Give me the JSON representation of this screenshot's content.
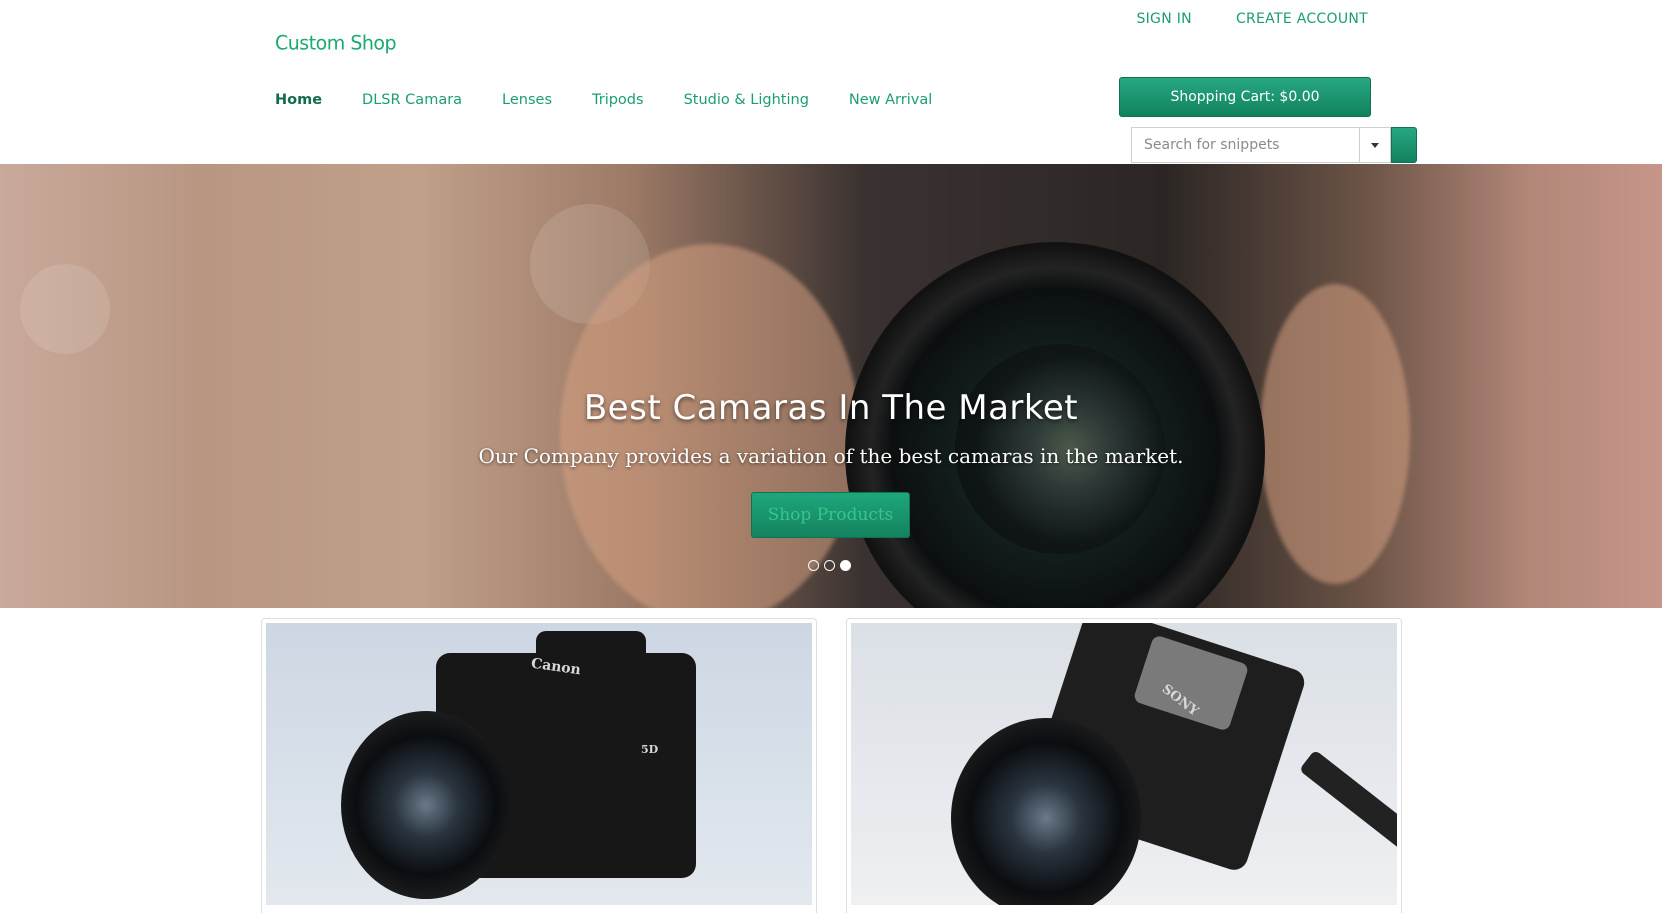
{
  "header": {
    "logo": "Custom Shop",
    "top_links": [
      "SIGN IN",
      "CREATE ACCOUNT"
    ],
    "nav": [
      {
        "label": "Home",
        "active": true
      },
      {
        "label": "DLSR Camara",
        "active": false
      },
      {
        "label": "Lenses",
        "active": false
      },
      {
        "label": "Tripods",
        "active": false
      },
      {
        "label": "Studio & Lighting",
        "active": false
      },
      {
        "label": "New Arrival",
        "active": false
      }
    ],
    "cart_label": "Shopping Cart: $0.00",
    "search": {
      "placeholder": "Search for snippets",
      "value": ""
    }
  },
  "hero": {
    "title": "Best Camaras In The Market",
    "subtitle": "Our Company provides a variation of the best camaras in the market.",
    "button": "Shop Products",
    "slides": 3,
    "active_slide": 3
  },
  "products": [
    {
      "brand_text": "Canon",
      "model_badge": "5D"
    },
    {
      "brand_text": "SONY"
    }
  ],
  "colors": {
    "accent": "#1b9e6f",
    "accent_dark": "#12825e",
    "nav_active": "#136b4e"
  }
}
